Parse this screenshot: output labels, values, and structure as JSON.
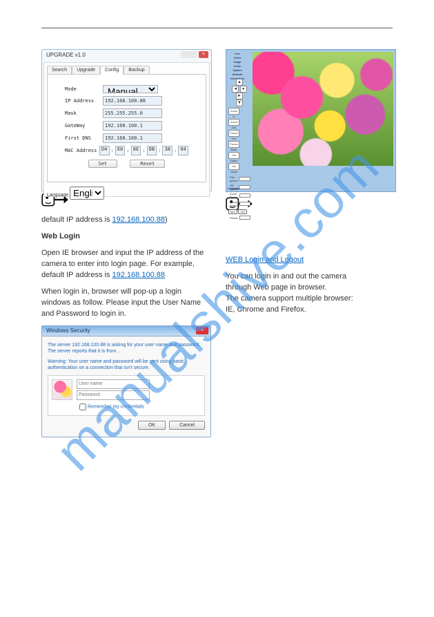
{
  "watermark": "manualshive.com",
  "upgrade": {
    "title": "UPGRADE v1.0",
    "tabs": [
      "Search",
      "Upgrade",
      "Config",
      "Backup"
    ],
    "active_tab": "Config",
    "fields": {
      "mode_label": "Mode",
      "mode_value": "Manual",
      "ip_label": "IP Address",
      "ip_value": "192.168.100.88",
      "mask_label": "Mask",
      "mask_value": "255.255.255.0",
      "gw_label": "GateWay",
      "gw_value": "192.168.100.1",
      "dns_label": "First DNS",
      "dns_value": "192.168.100.1",
      "mac_label": "MAC Address",
      "mac": [
        "D4",
        "E0",
        "8E",
        "DB",
        "38",
        "04"
      ]
    },
    "set_btn": "Set",
    "reset_btn": "Reset",
    "lang_label": "Language",
    "lang_value": "English"
  },
  "camera": {
    "nav": [
      "Live",
      "Video",
      "Image",
      "Audio",
      "System",
      "Network",
      "Information"
    ],
    "arrows": {
      "up": "▲",
      "down": "▼",
      "left": "◄",
      "right": "►",
      "center": "●"
    },
    "ctrl_btns": [
      "Zoom In",
      "Zoom Out",
      "Focus Far",
      "Focus Near",
      "Iris Open",
      "Iris Close",
      "Home"
    ],
    "sliders": [
      "Pan speed",
      "Tilt speed",
      "Zoom Speed",
      "Focus Speed"
    ],
    "bot_btns": [
      "960",
      "720"
    ],
    "preset_label": "Preset",
    "lang_label": "Language"
  },
  "text": {
    "p1_pre": "default IP address is ",
    "p1_ip": "192.168.100.88",
    "p1_post": ")",
    "link_heading": "WEB Login and Logout",
    "p2": "You can login in and out the camera\nthrough Web page in browser.\nThe camera support multiple browser:\nIE, Chrome and Firefox.",
    "login_header": "Web Login",
    "p3": "Open IE browser and input the IP address of the camera to enter into login page. For example, default IP address is",
    "p3_ip": "192.168.100.88",
    "p4": "When login in, browser will pop-up a login windows as follow. Please input the User Name and Password to login in."
  },
  "security": {
    "title": "Windows Security",
    "msg1": "The server 192.168.100.88 is asking for your user name and password. The server reports that it is from ..",
    "msg2": "Warning: Your user name and password will be sent using basic authentication on a connection that isn't secure.",
    "user_ph": "User name",
    "pass_ph": "Password",
    "remember": "Remember my credentials",
    "ok": "OK",
    "cancel": "Cancel"
  }
}
